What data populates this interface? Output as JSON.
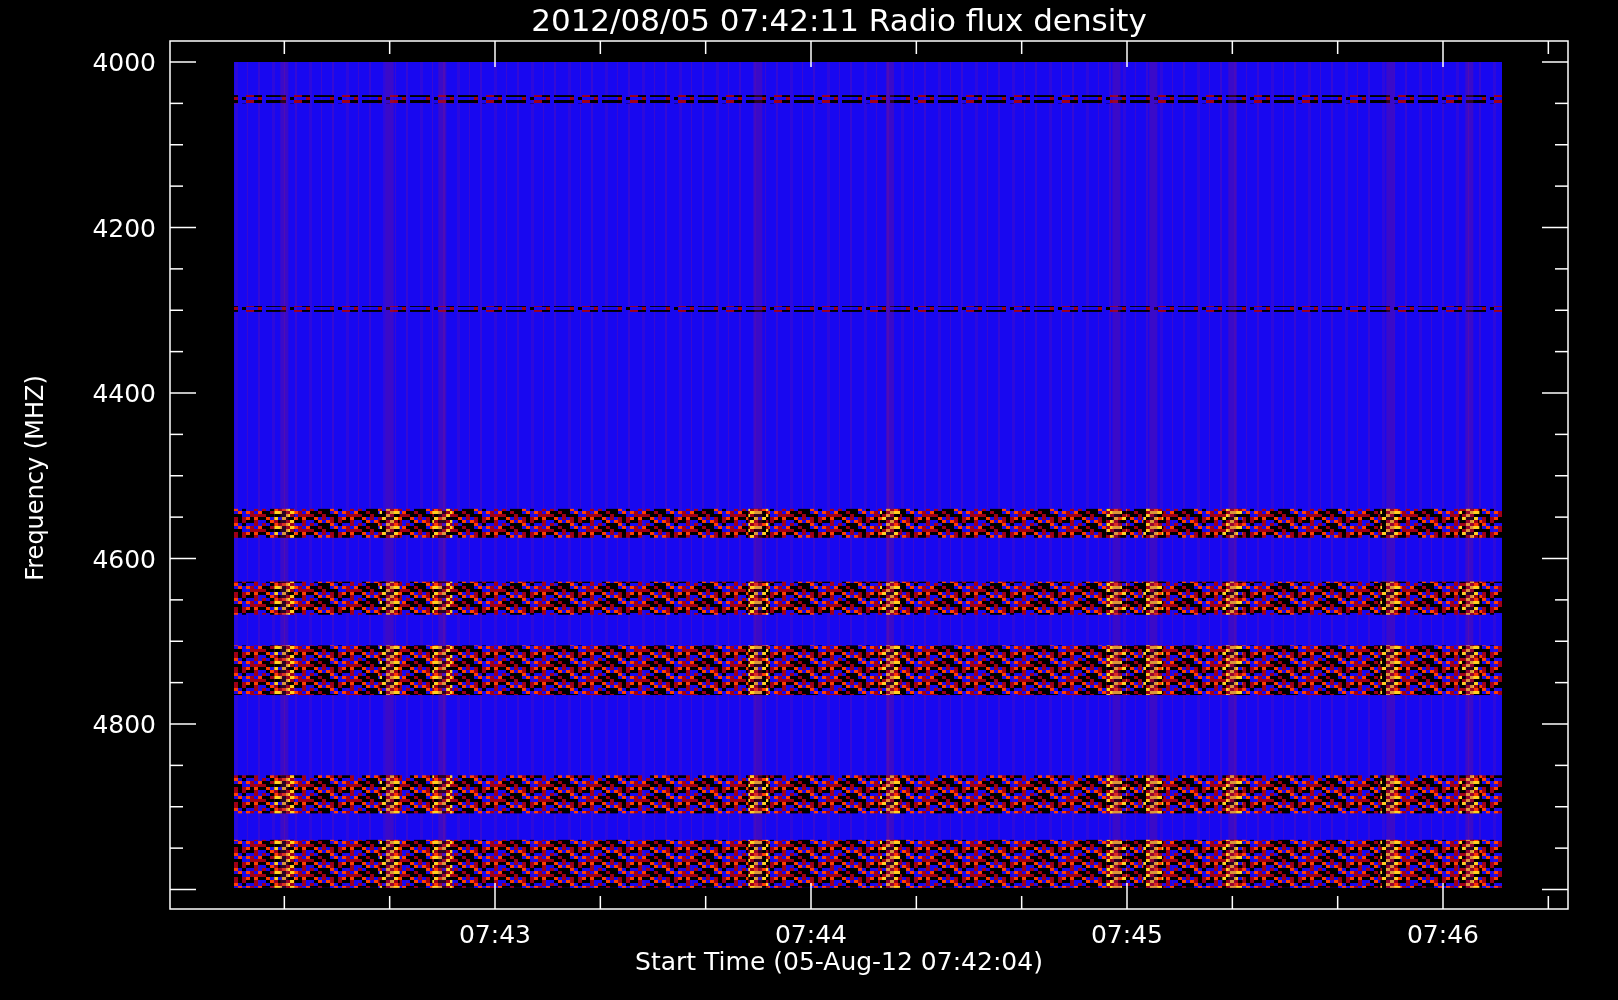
{
  "title": "2012/08/05 07:42:11 Radio flux density",
  "y_axis": {
    "label": "Frequency (MHZ)",
    "ticks": [
      "4000",
      "4200",
      "4400",
      "4600",
      "4800"
    ]
  },
  "x_axis": {
    "label": "Start Time (05-Aug-12 07:42:04)",
    "ticks": [
      "07:43",
      "07:44",
      "07:45",
      "07:46"
    ]
  }
}
